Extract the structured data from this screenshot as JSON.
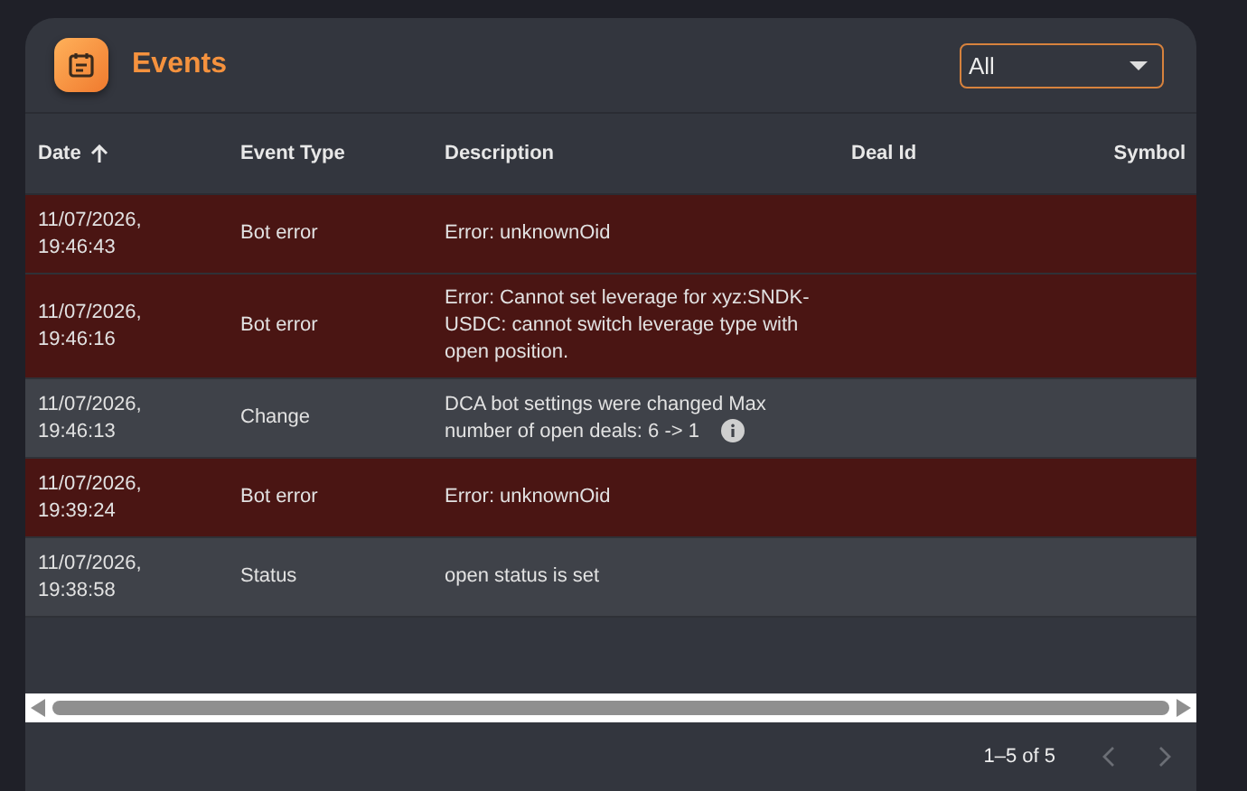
{
  "header": {
    "title": "Events",
    "filter": {
      "value": "All"
    }
  },
  "table": {
    "columns": [
      {
        "label": "Date",
        "sorted": true
      },
      {
        "label": "Event Type",
        "sorted": false
      },
      {
        "label": "Description",
        "sorted": false
      },
      {
        "label": "Deal Id",
        "sorted": false
      },
      {
        "label": "Symbol",
        "sorted": false
      }
    ],
    "rows": [
      {
        "kind": "error",
        "date": "11/07/2026,\n19:46:43",
        "type": "Bot error",
        "description": "Error: unknownOid",
        "info": false
      },
      {
        "kind": "error",
        "date": "11/07/2026,\n19:46:16",
        "type": "Bot error",
        "description": "Error: Cannot set leverage for xyz:SNDK-USDC: cannot switch leverage type with open position.",
        "info": false
      },
      {
        "kind": "normal",
        "date": "11/07/2026,\n19:46:13",
        "type": "Change",
        "description": "DCA bot settings were changed Max number of open deals: 6 -> 1",
        "info": true
      },
      {
        "kind": "error",
        "date": "11/07/2026,\n19:39:24",
        "type": "Bot error",
        "description": "Error: unknownOid",
        "info": false
      },
      {
        "kind": "normal",
        "date": "11/07/2026,\n19:38:58",
        "type": "Status",
        "description": "open status is set",
        "info": false
      }
    ]
  },
  "pagination": {
    "range": "1–5 of 5",
    "prev_disabled": true,
    "next_disabled": true
  }
}
